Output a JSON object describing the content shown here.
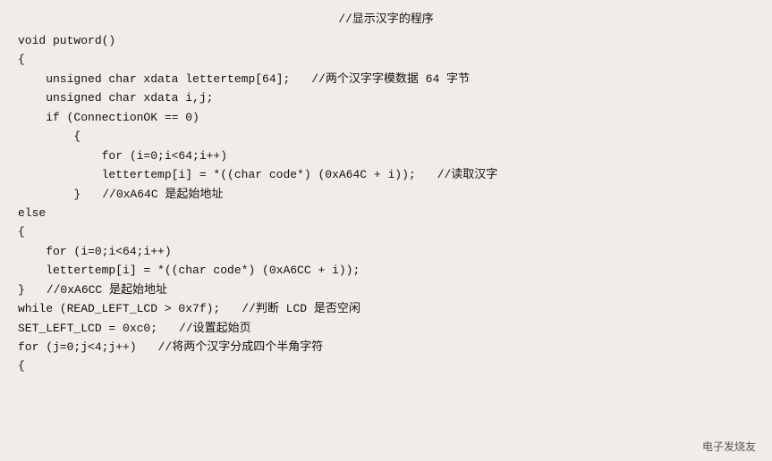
{
  "header": {
    "comment": "//显示汉字的程序"
  },
  "code": {
    "lines": [
      {
        "indent": 0,
        "code": "void putword()"
      },
      {
        "indent": 0,
        "code": "{"
      },
      {
        "indent": 1,
        "code": "    unsigned char xdata lettertemp[64];",
        "comment": "//两个汉字字模数据 64 字节"
      },
      {
        "indent": 1,
        "code": "    unsigned char xdata i,j;"
      },
      {
        "indent": 1,
        "code": "    if (ConnectionOK == 0)"
      },
      {
        "indent": 2,
        "code": "        {"
      },
      {
        "indent": 3,
        "code": "            for (i=0;i<64;i++)"
      },
      {
        "indent": 3,
        "code": "            lettertemp[i] = *((char code*) (0xA64C + i));",
        "comment": "//读取汉字"
      },
      {
        "indent": 2,
        "code": "        }",
        "comment": "//0xA64C 是起始地址"
      },
      {
        "indent": 0,
        "code": "else"
      },
      {
        "indent": 0,
        "code": "{"
      },
      {
        "indent": 1,
        "code": "    for (i=0;i<64;i++)"
      },
      {
        "indent": 1,
        "code": "    lettertemp[i] = *((char code*) (0xA6CC + i));"
      },
      {
        "indent": 0,
        "code": "}",
        "comment": "//0xA6CC 是起始地址"
      },
      {
        "indent": 0,
        "code": "while (READ_LEFT_LCD > 0x7f);",
        "comment": "//判断 LCD 是否空闲"
      },
      {
        "indent": 0,
        "code": "SET_LEFT_LCD = 0xc0;",
        "comment": "//设置起始页"
      },
      {
        "indent": 0,
        "code": "for (j=0;j<4;j++)",
        "comment": "//将两个汉字分成四个半角字符"
      },
      {
        "indent": 0,
        "code": "{"
      }
    ]
  }
}
